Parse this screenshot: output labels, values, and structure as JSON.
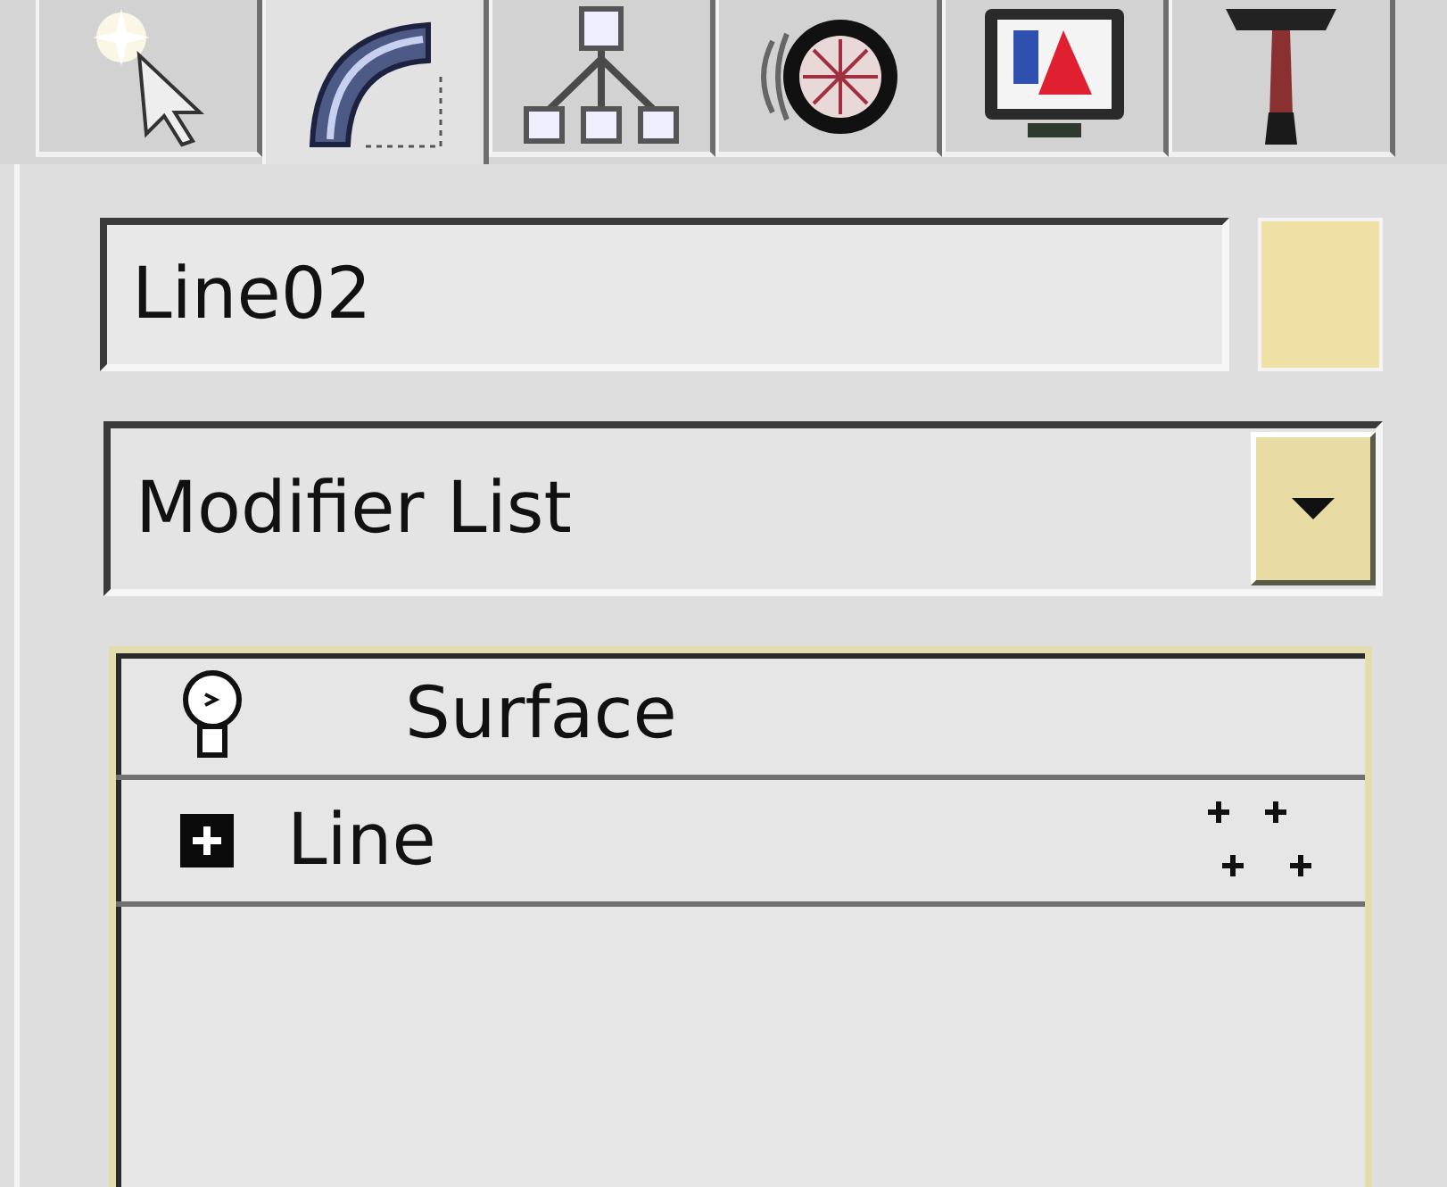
{
  "tabs": [
    {
      "kind": "create",
      "selected": false
    },
    {
      "kind": "modify",
      "selected": true
    },
    {
      "kind": "hierarchy",
      "selected": false
    },
    {
      "kind": "motion",
      "selected": false
    },
    {
      "kind": "display",
      "selected": false
    },
    {
      "kind": "utilities",
      "selected": false
    }
  ],
  "object_name": {
    "value": "Line02",
    "color": "#efe0a6"
  },
  "modifier_list": {
    "label": "Modifier List"
  },
  "stack": [
    {
      "kind": "modifier",
      "label": "Surface",
      "enabled": true
    },
    {
      "kind": "base",
      "label": "Line",
      "expanded": false
    }
  ]
}
